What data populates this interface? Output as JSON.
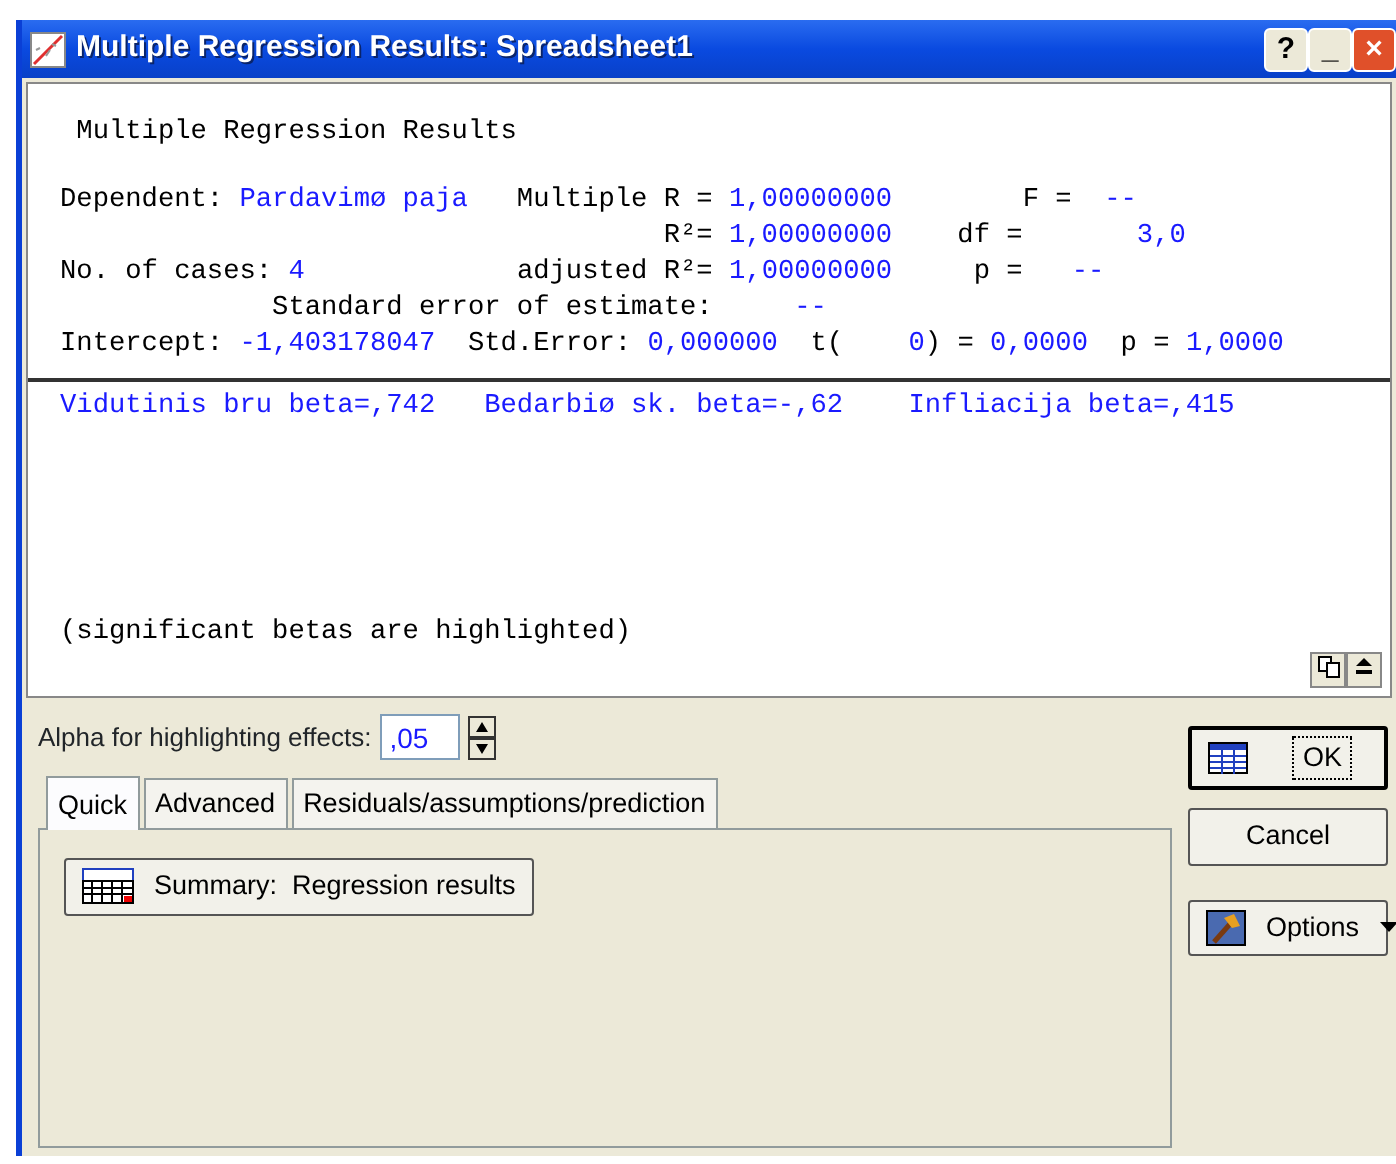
{
  "window": {
    "title": "Multiple Regression Results: Spreadsheet1",
    "buttons": [
      "?",
      "_",
      "×"
    ]
  },
  "results": {
    "lines": [
      [
        {
          "text": "Multiple Regression Results",
          "kind": "label"
        }
      ],
      [
        {
          "text": "Dependent:",
          "kind": "label"
        },
        {
          "text": "Pardavimø paja",
          "kind": "value"
        },
        {
          "text": "Multiple R =",
          "kind": "label"
        },
        {
          "text": "1,00000000",
          "kind": "value"
        },
        {
          "text": "F =",
          "kind": "label"
        },
        {
          "text": "--",
          "kind": "value"
        }
      ],
      [
        {
          "text": "R²=",
          "kind": "label"
        },
        {
          "text": "1,00000000",
          "kind": "value"
        },
        {
          "text": "df =",
          "kind": "label"
        },
        {
          "text": "3,0",
          "kind": "value"
        }
      ],
      [
        {
          "text": "No. of cases:",
          "kind": "label"
        },
        {
          "text": "4",
          "kind": "value"
        },
        {
          "text": "adjusted R²=",
          "kind": "label"
        },
        {
          "text": "1,00000000",
          "kind": "value"
        },
        {
          "text": "p =",
          "kind": "label"
        },
        {
          "text": "--",
          "kind": "value"
        }
      ],
      [
        {
          "text": "Standard error of estimate:",
          "kind": "label"
        },
        {
          "text": "--",
          "kind": "value"
        }
      ],
      [
        {
          "text": "Intercept:",
          "kind": "label"
        },
        {
          "text": "-1,403178047",
          "kind": "value"
        },
        {
          "text": "Std.Error:",
          "kind": "label"
        },
        {
          "text": "0,000000",
          "kind": "value"
        },
        {
          "text": "t(",
          "kind": "label"
        },
        {
          "text": "0",
          "kind": "value"
        },
        {
          "text": ") =",
          "kind": "label"
        },
        {
          "text": "0,0000",
          "kind": "value"
        },
        {
          "text": "p =",
          "kind": "label"
        },
        {
          "text": "1,0000",
          "kind": "value"
        }
      ]
    ],
    "betas": [
      "Vidutinis bru beta=,742",
      "Bedarbiø sk. beta=-,62",
      "Infliacija beta=,415"
    ],
    "note": "(significant betas are highlighted)"
  },
  "alpha": {
    "label": "Alpha for highlighting effects:",
    "value": ",05"
  },
  "tabs": [
    {
      "label": "Quick",
      "selected": true
    },
    {
      "label": "Advanced",
      "selected": false
    },
    {
      "label": "Residuals/assumptions/prediction",
      "selected": false
    }
  ],
  "quick_buttons": [
    "Summary:  Regression results"
  ],
  "side_buttons": [
    {
      "label": "OK",
      "kind": "ok"
    },
    {
      "label": "Cancel",
      "kind": "plain"
    },
    {
      "label": "Options",
      "kind": "menu"
    }
  ]
}
